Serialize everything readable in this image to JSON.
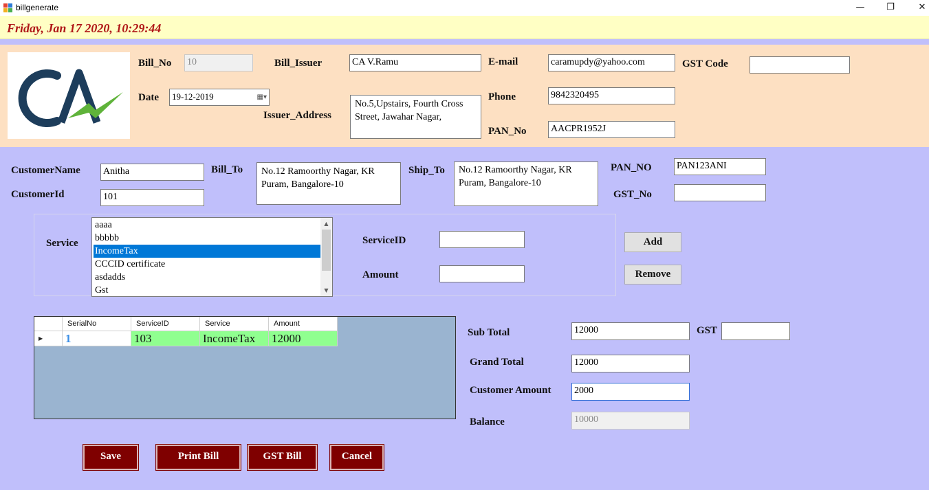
{
  "window": {
    "title": "billgenerate",
    "minimize": "—",
    "restore": "❐",
    "close": "✕"
  },
  "datetime": "Friday, Jan 17 2020, 10:29:44",
  "issuer": {
    "bill_no_label": "Bill_No",
    "bill_no": "10",
    "date_label": "Date",
    "date": "19-12-2019",
    "bill_issuer_label": "Bill_Issuer",
    "bill_issuer": "CA V.Ramu",
    "address_label": "Issuer_Address",
    "address": "No.5,Upstairs, Fourth Cross Street, Jawahar Nagar,",
    "email_label": "E-mail",
    "email": "caramupdy@yahoo.com",
    "phone_label": "Phone",
    "phone": "9842320495",
    "pan_label": "PAN_No",
    "pan": "AACPR1952J",
    "gst_code_label": "GST Code",
    "gst_code": ""
  },
  "customer": {
    "name_label": "CustomerName",
    "name": "Anitha",
    "id_label": "CustomerId",
    "id": "101",
    "bill_to_label": "Bill_To",
    "bill_to": "No.12 Ramoorthy Nagar, KR Puram, Bangalore-10",
    "ship_to_label": "Ship_To",
    "ship_to": "No.12 Ramoorthy Nagar, KR Puram, Bangalore-10",
    "pan_label": "PAN_NO",
    "pan": "PAN123ANI",
    "gst_label": "GST_No",
    "gst": ""
  },
  "service": {
    "label": "Service",
    "items": [
      "aaaa",
      "bbbbb",
      "IncomeTax",
      "CCCID certificate",
      "asdadds",
      "Gst"
    ],
    "selected_index": 2,
    "service_id_label": "ServiceID",
    "service_id": "",
    "amount_label": "Amount",
    "amount": "",
    "add": "Add",
    "remove": "Remove"
  },
  "grid": {
    "columns": [
      "SerialNo",
      "ServiceID",
      "Service",
      "Amount"
    ],
    "rows": [
      {
        "serial": "1",
        "service_id": "103",
        "service": "IncomeTax",
        "amount": "12000"
      }
    ]
  },
  "totals": {
    "subtotal_label": "Sub Total",
    "subtotal": "12000",
    "gst_label": "GST",
    "gst": "",
    "grand_label": "Grand Total",
    "grand": "12000",
    "customer_amount_label": "Customer Amount",
    "customer_amount": "2000",
    "balance_label": "Balance",
    "balance": "10000"
  },
  "actions": {
    "save": "Save",
    "print": "Print Bill",
    "gst_bill": "GST Bill",
    "cancel": "Cancel"
  },
  "colors": {
    "issuer_panel": "#fde0c2",
    "form_bg": "#c0bffb",
    "date_bg": "#ffffc4",
    "date_text": "#b01818",
    "action_button": "#7f0000",
    "grid_row": "#90ff90",
    "selection": "#0078d7"
  }
}
